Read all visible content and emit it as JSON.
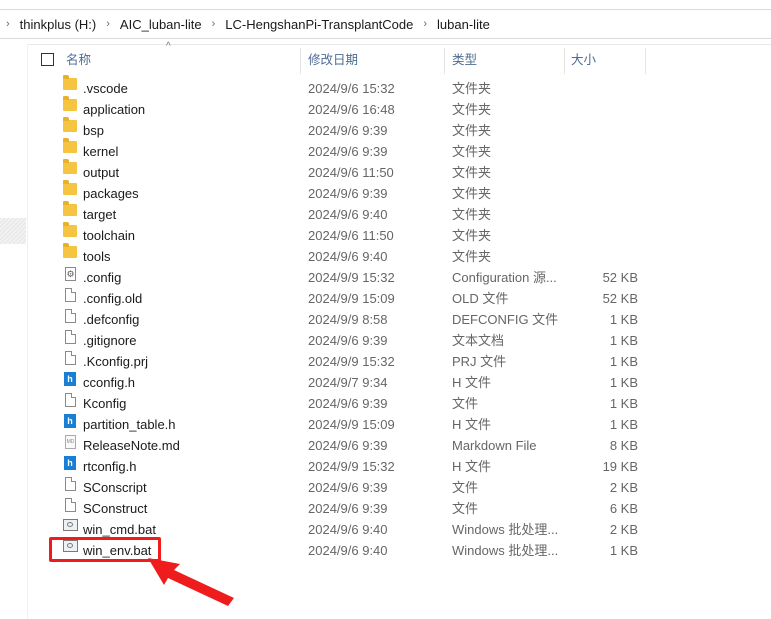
{
  "breadcrumb": [
    "thinkplus (H:)",
    "AIC_luban-lite",
    "LC-HengshanPi-TransplantCode",
    "luban-lite"
  ],
  "columns": {
    "name": "名称",
    "modified": "修改日期",
    "type": "类型",
    "size": "大小"
  },
  "files": [
    {
      "name": ".vscode",
      "date": "2024/9/6 15:32",
      "type": "文件夹",
      "size": "",
      "icon": "folder-icon"
    },
    {
      "name": "application",
      "date": "2024/9/6 16:48",
      "type": "文件夹",
      "size": "",
      "icon": "folder-icon"
    },
    {
      "name": "bsp",
      "date": "2024/9/6 9:39",
      "type": "文件夹",
      "size": "",
      "icon": "folder-icon"
    },
    {
      "name": "kernel",
      "date": "2024/9/6 9:39",
      "type": "文件夹",
      "size": "",
      "icon": "folder-icon"
    },
    {
      "name": "output",
      "date": "2024/9/6 11:50",
      "type": "文件夹",
      "size": "",
      "icon": "folder-icon"
    },
    {
      "name": "packages",
      "date": "2024/9/6 9:39",
      "type": "文件夹",
      "size": "",
      "icon": "folder-icon"
    },
    {
      "name": "target",
      "date": "2024/9/6 9:40",
      "type": "文件夹",
      "size": "",
      "icon": "folder-icon"
    },
    {
      "name": "toolchain",
      "date": "2024/9/6 11:50",
      "type": "文件夹",
      "size": "",
      "icon": "folder-icon"
    },
    {
      "name": "tools",
      "date": "2024/9/6 9:40",
      "type": "文件夹",
      "size": "",
      "icon": "folder-icon"
    },
    {
      "name": ".config",
      "date": "2024/9/9 15:32",
      "type": "Configuration 源...",
      "size": "52 KB",
      "icon": "config-file-icon"
    },
    {
      "name": ".config.old",
      "date": "2024/9/9 15:09",
      "type": "OLD 文件",
      "size": "52 KB",
      "icon": "file-icon"
    },
    {
      "name": ".defconfig",
      "date": "2024/9/9 8:58",
      "type": "DEFCONFIG 文件",
      "size": "1 KB",
      "icon": "file-icon"
    },
    {
      "name": ".gitignore",
      "date": "2024/9/6 9:39",
      "type": "文本文档",
      "size": "1 KB",
      "icon": "file-icon"
    },
    {
      "name": ".Kconfig.prj",
      "date": "2024/9/9 15:32",
      "type": "PRJ 文件",
      "size": "1 KB",
      "icon": "file-icon"
    },
    {
      "name": "cconfig.h",
      "date": "2024/9/7 9:34",
      "type": "H 文件",
      "size": "1 KB",
      "icon": "header-file-icon"
    },
    {
      "name": "Kconfig",
      "date": "2024/9/6 9:39",
      "type": "文件",
      "size": "1 KB",
      "icon": "file-icon"
    },
    {
      "name": "partition_table.h",
      "date": "2024/9/9 15:09",
      "type": "H 文件",
      "size": "1 KB",
      "icon": "header-file-icon"
    },
    {
      "name": "ReleaseNote.md",
      "date": "2024/9/6 9:39",
      "type": "Markdown File",
      "size": "8 KB",
      "icon": "markdown-file-icon"
    },
    {
      "name": "rtconfig.h",
      "date": "2024/9/9 15:32",
      "type": "H 文件",
      "size": "19 KB",
      "icon": "header-file-icon"
    },
    {
      "name": "SConscript",
      "date": "2024/9/6 9:39",
      "type": "文件",
      "size": "2 KB",
      "icon": "file-icon"
    },
    {
      "name": "SConstruct",
      "date": "2024/9/6 9:39",
      "type": "文件",
      "size": "6 KB",
      "icon": "file-icon"
    },
    {
      "name": "win_cmd.bat",
      "date": "2024/9/6 9:40",
      "type": "Windows 批处理...",
      "size": "2 KB",
      "icon": "batch-file-icon"
    },
    {
      "name": "win_env.bat",
      "date": "2024/9/6 9:40",
      "type": "Windows 批处理...",
      "size": "1 KB",
      "icon": "batch-file-icon"
    }
  ],
  "annotation": {
    "highlight_color": "#ee1c1c"
  }
}
